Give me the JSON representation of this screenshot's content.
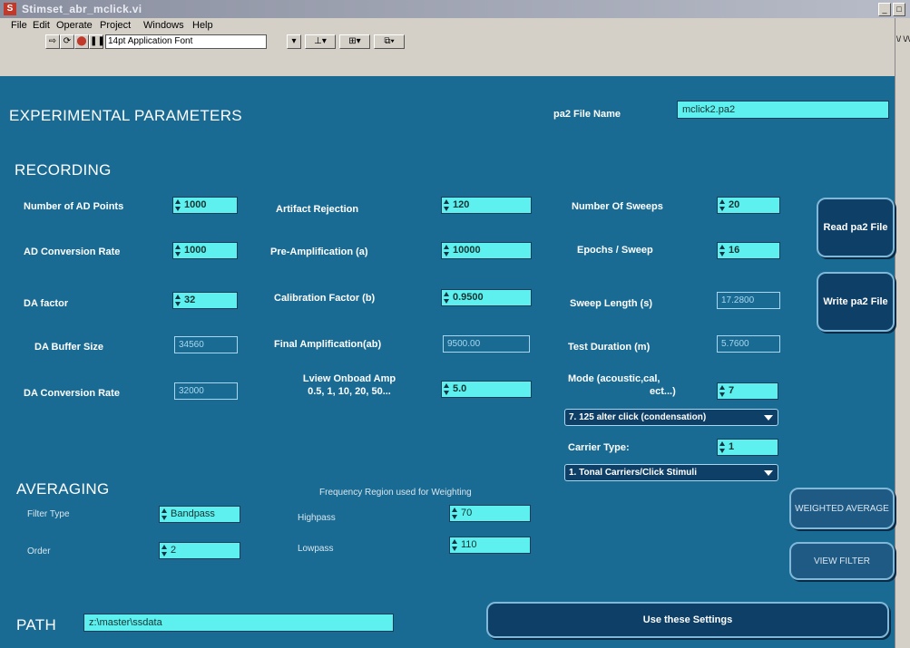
{
  "window": {
    "title": "Stimset_abr_mclick.vi",
    "min": "_",
    "close": "□"
  },
  "menu": [
    "File",
    "Edit",
    "Operate",
    "Project",
    "Windows",
    "Help"
  ],
  "toolbar": {
    "font_select": "14pt Application Font",
    "icon_strip": "\\/ \\/\\"
  },
  "panel": {
    "heading": "EXPERIMENTAL PARAMETERS",
    "file_label": "pa2 File Name",
    "file_value": "mclick2.pa2",
    "recording": {
      "heading": "RECORDING",
      "num_ad_points_label": "Number of AD Points",
      "num_ad_points": "1000",
      "ad_rate_label": "AD Conversion Rate",
      "ad_rate": "1000",
      "da_factor_label": "DA factor",
      "da_factor": "32",
      "da_buffer_label": "DA Buffer Size",
      "da_buffer": "34560",
      "da_rate_label": "DA Conversion Rate",
      "da_rate": "32000",
      "artifact_label": "Artifact Rejection",
      "artifact": "120",
      "preamp_label": "Pre-Amplification (a)",
      "preamp": "10000",
      "calib_label": "Calibration Factor (b)",
      "calib": "0.9500",
      "final_amp_label": "Final Amplification(ab)",
      "final_amp": "9500.00",
      "lview_label_1": "Lview Onboad Amp",
      "lview_label_2": "0.5, 1, 10, 20, 50...",
      "lview": "5.0",
      "sweeps_label": "Number Of Sweeps",
      "sweeps": "20",
      "epochs_label": "Epochs / Sweep",
      "epochs": "16",
      "sweep_len_label": "Sweep Length (s)",
      "sweep_len": "17.2800",
      "test_dur_label": "Test Duration (m)",
      "test_dur": "5.7600",
      "mode_label_1": "Mode (acoustic,cal,",
      "mode_label_2": "ect...)",
      "mode": "7",
      "mode_ring": "7. 125 alter click (condensation)",
      "carrier_label": "Carrier Type:",
      "carrier": "1",
      "carrier_ring": "1. Tonal Carriers/Click Stimuli"
    },
    "averaging": {
      "heading": "AVERAGING",
      "freq_region_label": "Frequency Region used for Weighting",
      "filter_type_label": "Filter Type",
      "filter_type": "Bandpass",
      "order_label": "Order",
      "order": "2",
      "highpass_label": "Highpass",
      "highpass": "70",
      "lowpass_label": "Lowpass",
      "lowpass": "110"
    },
    "path": {
      "heading": "PATH",
      "value": "z:\\master\\ssdata"
    },
    "buttons": {
      "read": "Read pa2 File",
      "write": "Write pa2 File",
      "weighted": "WEIGHTED AVERAGE",
      "view_filter": "VIEW FILTER",
      "use": "Use these Settings"
    }
  }
}
